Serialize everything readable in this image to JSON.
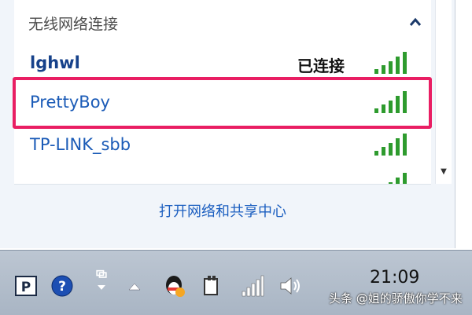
{
  "section": {
    "title": "无线网络连接",
    "collapse_icon": "chevron-up-icon"
  },
  "networks": [
    {
      "name": "lghwl",
      "status": "已连接",
      "signal_bars": 5,
      "connected": true
    },
    {
      "name": "PrettyBoy",
      "status": "",
      "signal_bars": 5,
      "connected": false,
      "highlighted": true
    },
    {
      "name": "TP-LINK_sbb",
      "status": "",
      "signal_bars": 5,
      "connected": false
    },
    {
      "name": "",
      "status": "",
      "signal_bars": 5,
      "connected": false
    }
  ],
  "footer": {
    "link_label": "打开网络和共享中心"
  },
  "taskbar": {
    "icons": [
      "input-method-icon",
      "help-icon",
      "network-adapter-icon",
      "show-hidden-icons",
      "qq-icon",
      "safely-remove-hardware-icon",
      "network-signal-icon",
      "volume-icon"
    ],
    "clock": "21:09"
  },
  "watermark": "头条 @姐的骄傲你学不来",
  "colors": {
    "highlight": "#e91e63",
    "link": "#1c5fc0",
    "signal_green": "#2e9b2e"
  }
}
